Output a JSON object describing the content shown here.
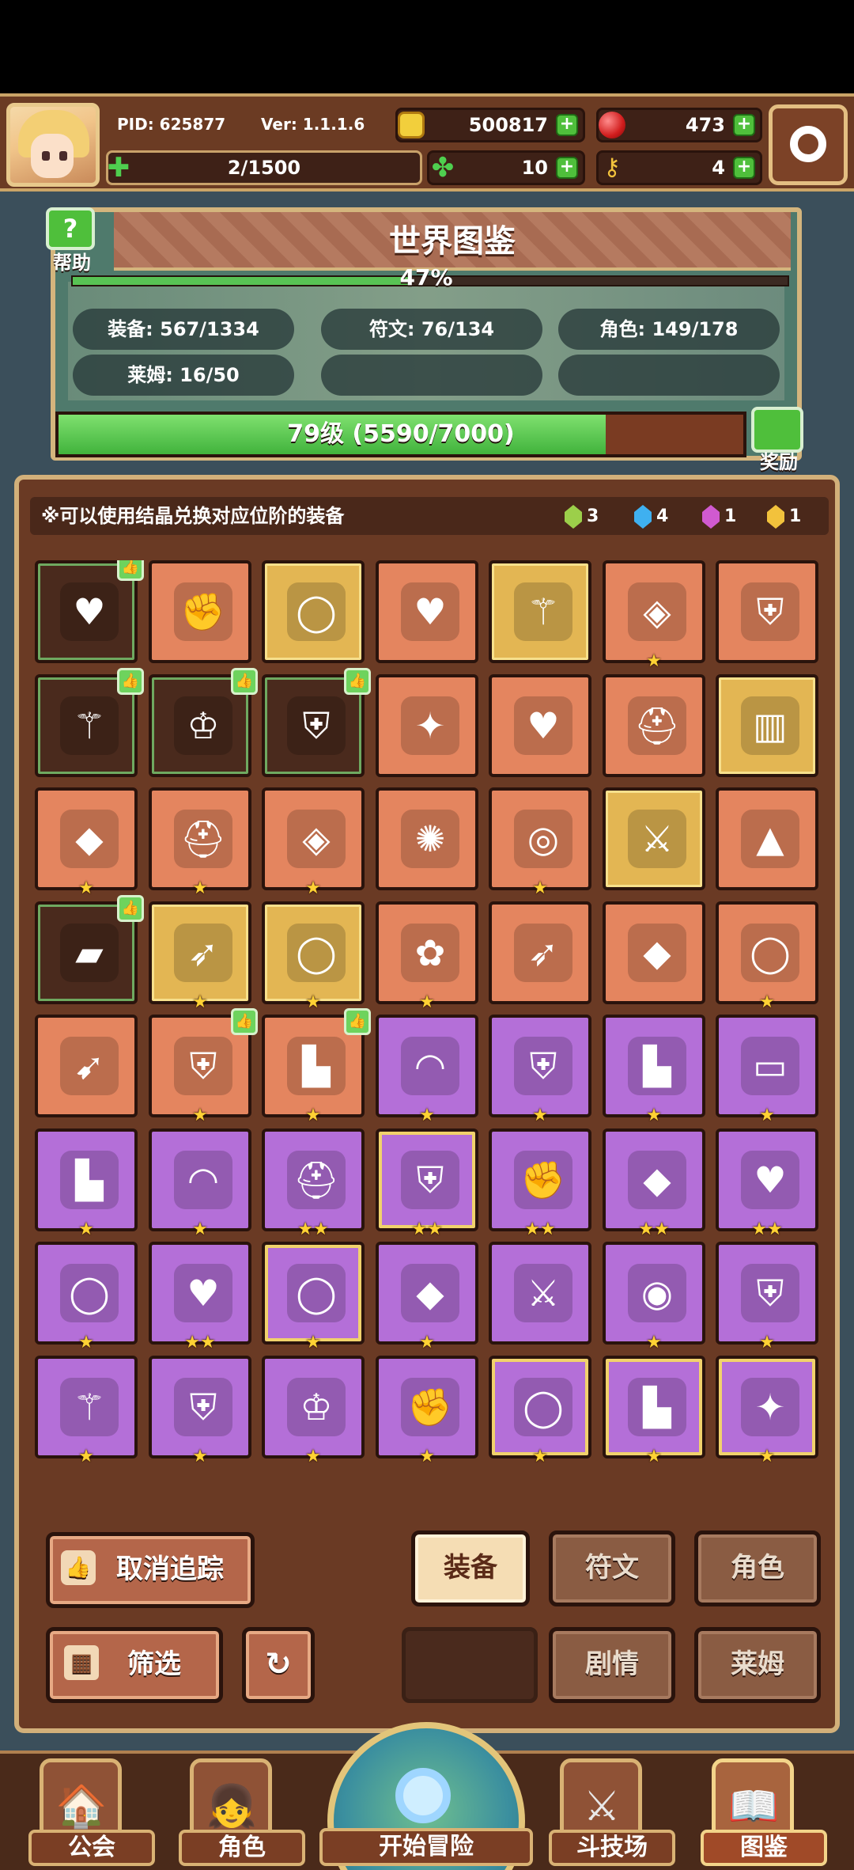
{
  "header": {
    "pid": "PID: 625877",
    "version": "Ver: 1.1.1.6",
    "gold": "500817",
    "ruby": "473",
    "stamina": "2/1500",
    "clover": "10",
    "keys": "4",
    "icons": {
      "gold": "gold-coin-icon",
      "ruby": "ruby-gem-icon",
      "stamina": "clover-stamina-icon",
      "clover": "four-leaf-clover-icon",
      "keys": "key-icon",
      "settings": "gear-icon"
    }
  },
  "collection": {
    "title": "世界图鉴",
    "help_label": "帮助",
    "progress_text": "47%",
    "progress_value": 0.47,
    "stats": {
      "equipment": "装备: 567/1334",
      "runes": "符文: 76/134",
      "characters": "角色: 149/178",
      "slimes": "莱姆: 16/50"
    },
    "level_text": "79级 (5590/7000)",
    "level_fill": 0.7986,
    "reward_label": "奖励"
  },
  "grid_panel": {
    "note": "※可以使用结晶兑换对应位阶的装备",
    "crystals": [
      {
        "name": "green-crystal",
        "count": "3",
        "color": "#9ccf4a"
      },
      {
        "name": "blue-crystal",
        "count": "4",
        "color": "#3fb0f0"
      },
      {
        "name": "purple-crystal",
        "count": "1",
        "color": "#d05ad0"
      },
      {
        "name": "gold-crystal",
        "count": "1",
        "color": "#f2c23c"
      }
    ],
    "items": [
      {
        "name": "heart-necklace",
        "icon": "♥",
        "bg": "d",
        "stars": "",
        "tracked": true
      },
      {
        "name": "gauntlet",
        "icon": "✊",
        "bg": "o",
        "stars": "",
        "tracked": false
      },
      {
        "name": "gold-ring",
        "icon": "◯",
        "bg": "g",
        "stars": "",
        "tracked": false
      },
      {
        "name": "heart-amulet",
        "icon": "♥",
        "bg": "o",
        "stars": "",
        "tracked": false
      },
      {
        "name": "golden-staff",
        "icon": "⚚",
        "bg": "g",
        "stars": "",
        "tracked": false
      },
      {
        "name": "ruby-amulet",
        "icon": "◈",
        "bg": "o",
        "stars": "★",
        "tracked": false
      },
      {
        "name": "chest-armor",
        "icon": "⛨",
        "bg": "o",
        "stars": "",
        "tracked": false
      },
      {
        "name": "wooden-club",
        "icon": "⚚",
        "bg": "d",
        "stars": "",
        "tracked": true
      },
      {
        "name": "iron-crown",
        "icon": "♔",
        "bg": "d",
        "stars": "",
        "tracked": true
      },
      {
        "name": "leather-vest",
        "icon": "⛨",
        "bg": "d",
        "stars": "",
        "tracked": true
      },
      {
        "name": "silver-cross-amulet",
        "icon": "✦",
        "bg": "o",
        "stars": "",
        "tracked": false
      },
      {
        "name": "blue-gem-necklace",
        "icon": "♥",
        "bg": "o",
        "stars": "",
        "tracked": false
      },
      {
        "name": "winged-helmet",
        "icon": "⛑",
        "bg": "o",
        "stars": "",
        "tracked": false
      },
      {
        "name": "gold-bucket-helm",
        "icon": "▥",
        "bg": "g",
        "stars": "",
        "tracked": false
      },
      {
        "name": "gold-shield-pendant",
        "icon": "◆",
        "bg": "o",
        "stars": "★",
        "tracked": false
      },
      {
        "name": "gold-helmet",
        "icon": "⛑",
        "bg": "o",
        "stars": "★",
        "tracked": false
      },
      {
        "name": "ruby-collar",
        "icon": "◈",
        "bg": "o",
        "stars": "★",
        "tracked": false
      },
      {
        "name": "sun-ring",
        "icon": "✺",
        "bg": "o",
        "stars": "",
        "tracked": false
      },
      {
        "name": "red-bracelet",
        "icon": "◎",
        "bg": "o",
        "stars": "★",
        "tracked": false
      },
      {
        "name": "jade-sword",
        "icon": "⚔",
        "bg": "g",
        "stars": "",
        "tracked": false
      },
      {
        "name": "green-hood",
        "icon": "▲",
        "bg": "o",
        "stars": "",
        "tracked": false
      },
      {
        "name": "green-cloak",
        "icon": "▰",
        "bg": "d",
        "stars": "",
        "tracked": true
      },
      {
        "name": "steel-spear",
        "icon": "➶",
        "bg": "g",
        "stars": "★",
        "tracked": false
      },
      {
        "name": "jeweled-ring",
        "icon": "◯",
        "bg": "g",
        "stars": "★",
        "tracked": false
      },
      {
        "name": "flower-amulet",
        "icon": "✿",
        "bg": "o",
        "stars": "★",
        "tracked": false
      },
      {
        "name": "golden-arrow",
        "icon": "➶",
        "bg": "o",
        "stars": "",
        "tracked": false
      },
      {
        "name": "ruby-medallion",
        "icon": "◆",
        "bg": "o",
        "stars": "",
        "tracked": false
      },
      {
        "name": "ruby-ring",
        "icon": "◯",
        "bg": "o",
        "stars": "★",
        "tracked": false
      },
      {
        "name": "crossbow",
        "icon": "➹",
        "bg": "o",
        "stars": "",
        "tracked": false
      },
      {
        "name": "crystal-armor",
        "icon": "⛨",
        "bg": "o",
        "stars": "★",
        "tracked": true
      },
      {
        "name": "crystal-boots",
        "icon": "▙",
        "bg": "o",
        "stars": "★",
        "tracked": true
      },
      {
        "name": "fur-collar",
        "icon": "◠",
        "bg": "p",
        "stars": "★",
        "tracked": false
      },
      {
        "name": "iron-chestplate",
        "icon": "⛨",
        "bg": "p",
        "stars": "★",
        "tracked": false
      },
      {
        "name": "red-boots",
        "icon": "▙",
        "bg": "p",
        "stars": "★",
        "tracked": false
      },
      {
        "name": "flintlock-pistol",
        "icon": "▭",
        "bg": "p",
        "stars": "★",
        "tracked": false
      },
      {
        "name": "silver-boot",
        "icon": "▙",
        "bg": "p",
        "stars": "★",
        "tracked": false
      },
      {
        "name": "leather-necklace",
        "icon": "◠",
        "bg": "p",
        "stars": "★",
        "tracked": false
      },
      {
        "name": "dark-helmet",
        "icon": "⛑",
        "bg": "p",
        "stars": "★★",
        "tracked": false
      },
      {
        "name": "dark-armor",
        "icon": "⛨",
        "bg": "pg",
        "stars": "★★",
        "tracked": false
      },
      {
        "name": "dark-gauntlet",
        "icon": "✊",
        "bg": "p",
        "stars": "★★",
        "tracked": false
      },
      {
        "name": "gold-star-medallion",
        "icon": "◆",
        "bg": "p",
        "stars": "★★",
        "tracked": false
      },
      {
        "name": "dark-heart-necklace",
        "icon": "♥",
        "bg": "p",
        "stars": "★★",
        "tracked": false
      },
      {
        "name": "dark-ring",
        "icon": "◯",
        "bg": "p",
        "stars": "★",
        "tracked": false
      },
      {
        "name": "gem-necklace",
        "icon": "♥",
        "bg": "p",
        "stars": "★★",
        "tracked": false
      },
      {
        "name": "diamond-ring",
        "icon": "◯",
        "bg": "pg",
        "stars": "★",
        "tracked": false
      },
      {
        "name": "diamond-amulet",
        "icon": "◆",
        "bg": "p",
        "stars": "★",
        "tracked": false
      },
      {
        "name": "silver-sword",
        "icon": "⚔",
        "bg": "p",
        "stars": "",
        "tracked": false
      },
      {
        "name": "round-shield",
        "icon": "◉",
        "bg": "p",
        "stars": "★",
        "tracked": false
      },
      {
        "name": "ruby-chestplate",
        "icon": "⛨",
        "bg": "p",
        "stars": "★",
        "tracked": false
      },
      {
        "name": "star-scepter",
        "icon": "⚚",
        "bg": "p",
        "stars": "★",
        "tracked": false
      },
      {
        "name": "gilded-armor",
        "icon": "⛨",
        "bg": "p",
        "stars": "★",
        "tracked": false
      },
      {
        "name": "gold-crown-helm",
        "icon": "♔",
        "bg": "p",
        "stars": "★",
        "tracked": false
      },
      {
        "name": "dark-gloves",
        "icon": "✊",
        "bg": "p",
        "stars": "★",
        "tracked": false
      },
      {
        "name": "black-ring",
        "icon": "◯",
        "bg": "pg",
        "stars": "★",
        "tracked": false
      },
      {
        "name": "gold-boots",
        "icon": "▙",
        "bg": "pg",
        "stars": "★",
        "tracked": false
      },
      {
        "name": "gem-brooch",
        "icon": "✦",
        "bg": "pg",
        "stars": "★",
        "tracked": false
      }
    ]
  },
  "buttons": {
    "untrack": "取消追踪",
    "filter": "筛选",
    "equipment": "装备",
    "runes": "符文",
    "characters": "角色",
    "story": "剧情",
    "slimes": "莱姆"
  },
  "nav": {
    "guild": "公会",
    "characters": "角色",
    "adventure": "开始冒险",
    "arena": "斗技场",
    "collection": "图鉴"
  }
}
